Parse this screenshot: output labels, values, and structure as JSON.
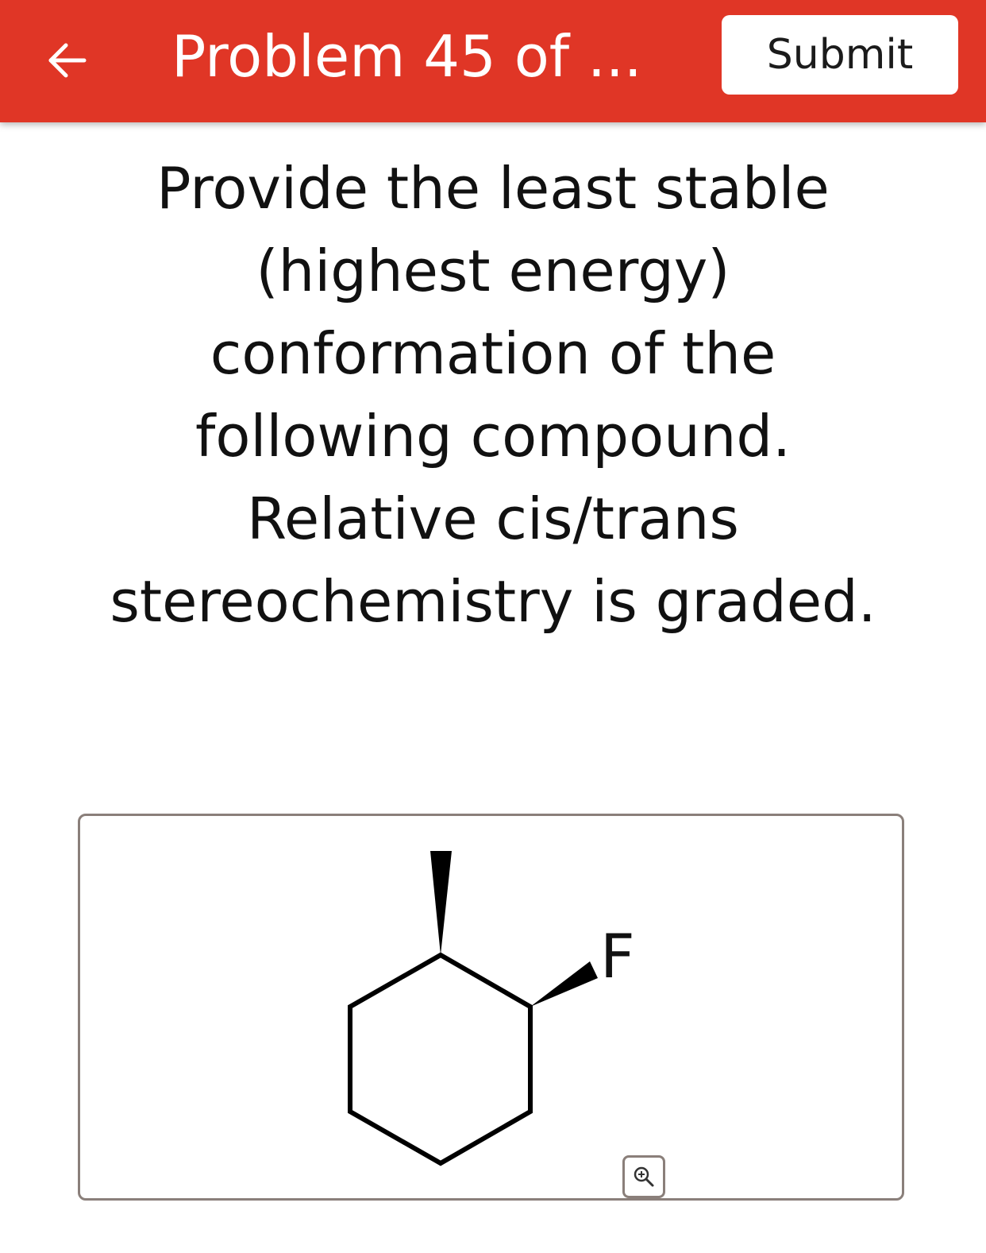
{
  "header": {
    "title": "Problem 45 of ...",
    "submit_label": "Submit",
    "back_icon": "arrow-left-icon"
  },
  "question": {
    "lines": [
      "Provide the least stable",
      "(highest energy)",
      "conformation of the",
      "following compound.",
      "Relative cis/trans",
      "stereochemistry is graded."
    ]
  },
  "molecule": {
    "substituent_label": "F",
    "zoom_icon": "zoom-in-icon"
  },
  "colors": {
    "header_background": "#e03626",
    "header_text": "#ffffff",
    "panel_border": "#8a7f7a",
    "text": "#111111"
  }
}
